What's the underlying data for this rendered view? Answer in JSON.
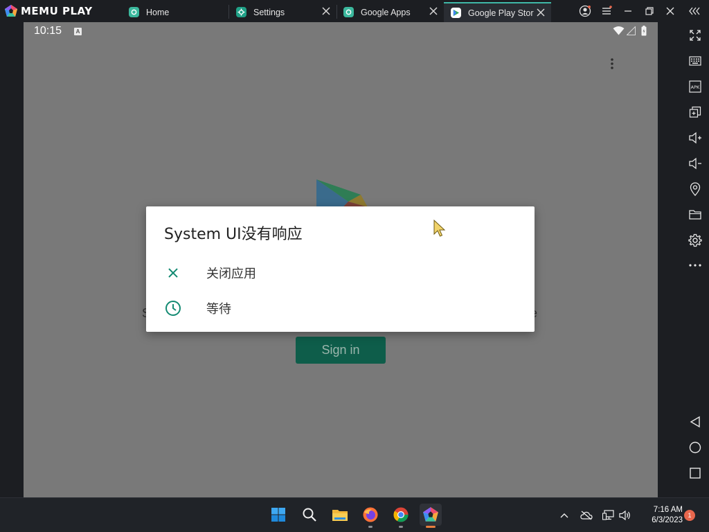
{
  "emulator": {
    "brand": "MEMU PLAY",
    "tabs": [
      {
        "label": "Home",
        "icon": "memu-app-icon"
      },
      {
        "label": "Settings",
        "icon": "settings-gear-icon"
      },
      {
        "label": "Google Apps",
        "icon": "memu-app-icon"
      },
      {
        "label": "Google Play Stor",
        "icon": "play-store-icon"
      }
    ]
  },
  "android": {
    "status": {
      "time": "10:15",
      "badge": "A"
    },
    "background": {
      "text_left_fragment": "S",
      "text_right_fragment": "e",
      "signin_label": "Sign in"
    },
    "dialog": {
      "title": "System UI没有响应",
      "options": [
        {
          "label": "关闭应用",
          "icon": "close-x-icon"
        },
        {
          "label": "等待",
          "icon": "clock-icon"
        }
      ]
    }
  },
  "taskbar": {
    "time": "7:16 AM",
    "date": "6/3/2023",
    "notification_count": "1"
  },
  "colors": {
    "accent_teal": "#138a72",
    "tab_accent": "#3fb9a8",
    "signin_green": "#0e5d4a",
    "notification": "#e8674d"
  }
}
